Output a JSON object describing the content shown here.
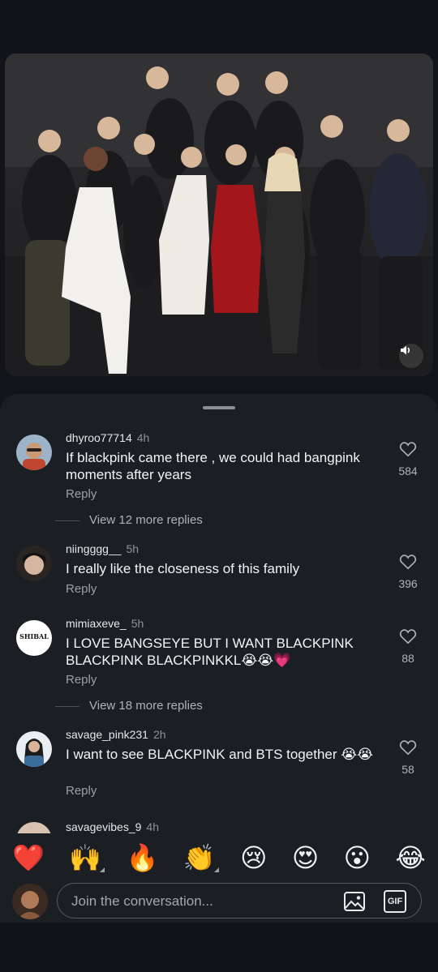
{
  "comments": [
    {
      "username": "dhyroo77714",
      "time": "4h",
      "text": "If blackpink came there , we could had bangpink moments after years",
      "reply_label": "Reply",
      "likes": "584",
      "view_more": "View 12 more replies"
    },
    {
      "username": "niingggg__",
      "time": "5h",
      "text": "I really like the closeness of this family",
      "reply_label": "Reply",
      "likes": "396"
    },
    {
      "username": "mimiaxeve_",
      "time": "5h",
      "text": "I LOVE BANGSEYE BUT I WANT BLACKPINK BLACKPINK BLACKPINKKL😭😭💗",
      "avatar_text": "SHIBAL",
      "reply_label": "Reply",
      "likes": "88",
      "view_more": "View 18 more replies"
    },
    {
      "username": "savage_pink231",
      "time": "2h",
      "text": "I want to see BLACKPINK and BTS together 😭😭",
      "reply_label": "Reply",
      "likes": "58"
    },
    {
      "username": "savagevibes_9",
      "time": "4h"
    }
  ],
  "reactions": [
    "❤️",
    "🙌",
    "🔥",
    "👏",
    "😢",
    "😍",
    "😮",
    "😂"
  ],
  "composer": {
    "placeholder": "Join the conversation...",
    "gif_label": "GIF"
  },
  "colors": {
    "sheet_bg": "#1b1f24",
    "page_bg": "#11151a",
    "muted_text": "#9aa0a6"
  }
}
